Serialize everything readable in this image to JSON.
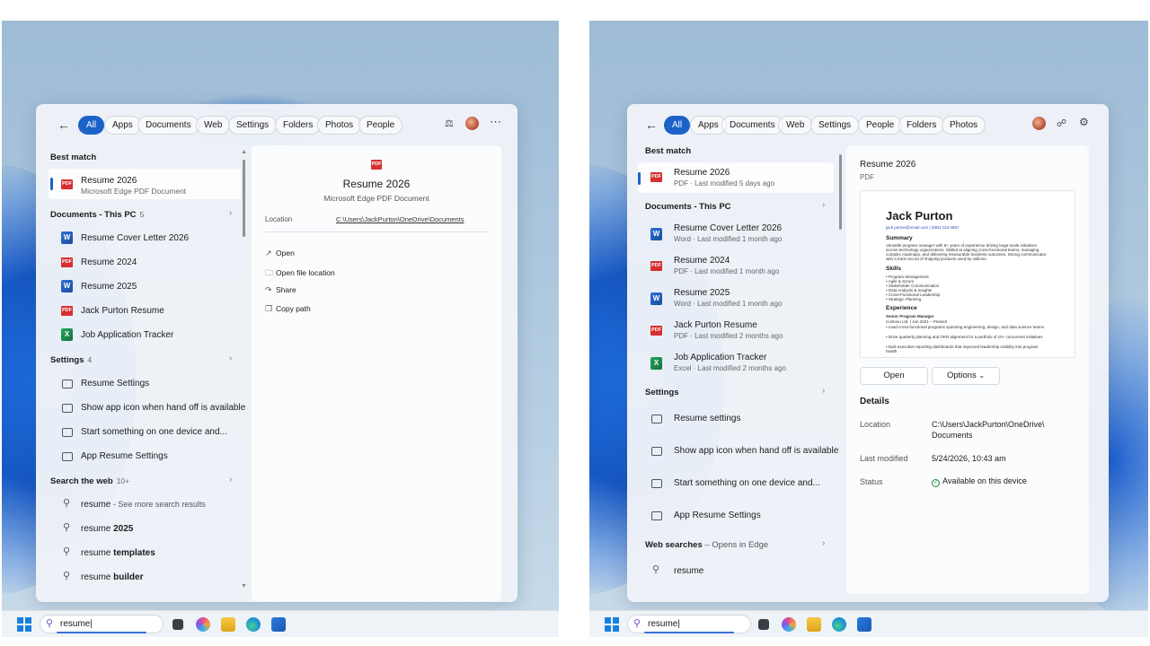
{
  "left": {
    "filters": [
      "All",
      "Apps",
      "Documents",
      "Web",
      "Settings",
      "Folders",
      "Photos",
      "People"
    ],
    "best_match_header": "Best match",
    "best_match": {
      "title": "Resume 2026",
      "subtitle": "Microsoft Edge PDF Document"
    },
    "documents_header": "Documents - This PC",
    "documents_count": "5",
    "documents": [
      {
        "title": "Resume Cover Letter 2026",
        "icon": "word-icon"
      },
      {
        "title": "Resume 2024",
        "icon": "pdf-icon"
      },
      {
        "title": "Resume 2025",
        "icon": "word-icon"
      },
      {
        "title": "Jack Purton Resume",
        "icon": "pdf-icon"
      },
      {
        "title": "Job Application Tracker",
        "icon": "excel-icon"
      }
    ],
    "settings_header": "Settings",
    "settings_count": "4",
    "settings": [
      "Resume Settings",
      "Show app icon when hand off is available",
      "Start something on one device and...",
      "App Resume Settings"
    ],
    "web_header": "Search the web",
    "web_count": "10+",
    "web": [
      {
        "pre": "resume",
        "post": " - See more search results",
        "bold": false
      },
      {
        "pre": "resume ",
        "post": "2025",
        "bold": true
      },
      {
        "pre": "resume ",
        "post": "templates",
        "bold": true
      },
      {
        "pre": "resume ",
        "post": "builder",
        "bold": true
      }
    ],
    "preview": {
      "icon_label": "PDF",
      "title": "Resume 2026",
      "subtitle": "Microsoft Edge PDF Document",
      "location_label": "Location",
      "location_value": "C:\\Users\\JackPurton\\OneDrive\\Documents",
      "actions": [
        "Open",
        "Open file location",
        "Share",
        "Copy path"
      ]
    },
    "search_text": "resume"
  },
  "right": {
    "filters": [
      "All",
      "Apps",
      "Documents",
      "Web",
      "Settings",
      "People",
      "Folders",
      "Photos"
    ],
    "best_match_header": "Best match",
    "best_match": {
      "title": "Resume 2026",
      "subtitle": "PDF · Last modified 5 days ago"
    },
    "documents_header": "Documents - This PC",
    "documents": [
      {
        "title": "Resume Cover Letter 2026",
        "subtitle": "Word · Last modified 1 month ago",
        "icon": "word-icon"
      },
      {
        "title": "Resume 2024",
        "subtitle": "PDF · Last modified 1 month ago",
        "icon": "pdf-icon"
      },
      {
        "title": "Resume 2025",
        "subtitle": "Word · Last modified 1 month ago",
        "icon": "word-icon"
      },
      {
        "title": "Jack Purton Resume",
        "subtitle": "PDF · Last modified 2 months ago",
        "icon": "pdf-icon"
      },
      {
        "title": "Job Application Tracker",
        "subtitle": "Excel · Last modified 2 months ago",
        "icon": "excel-icon"
      }
    ],
    "settings_header": "Settings",
    "settings": [
      "Resume settings",
      "Show app icon when hand off is available",
      "Start something on one device and...",
      "App Resume Settings"
    ],
    "web_header": "Web searches",
    "web_sub": " – Opens in Edge",
    "web": [
      "resume"
    ],
    "preview": {
      "title": "Resume 2026",
      "type": "PDF",
      "doc": {
        "name": "Jack Purton",
        "contact": "jack.purton@email.com | (555) 123-4567",
        "summary_h": "Summary",
        "summary": "Versatile program manager with 8+ years of experience driving large-scale initiatives across technology organizations. Skilled at aligning cross-functional teams, managing complex roadmaps, and delivering measurable business outcomes. Strong communicator with a track record of shipping products used by millions.",
        "skills_h": "Skills",
        "skills": [
          "• Program Management",
          "• Agile & Scrum",
          "• Stakeholder Communication",
          "• Data Analysis & Insights",
          "• Cross-Functional Leadership",
          "• Strategic Planning"
        ],
        "exp_h": "Experience",
        "role": "Senior Program Manager",
        "company": "Contoso Ltd. | Jan 2021 – Present",
        "bullets": [
          "• Lead cross-functional programs spanning engineering, design, and data science teams",
          "• Drive quarterly planning and OKR alignment for a portfolio of 10+ concurrent initiatives",
          "• Built executive reporting dashboards that improved leadership visibility into program health"
        ]
      },
      "open_label": "Open",
      "options_label": "Options",
      "details_header": "Details",
      "location_label": "Location",
      "location_value_1": "C:\\Users\\JackPurton\\OneDrive\\",
      "location_value_2": "Documents",
      "modified_label": "Last modified",
      "modified_value": "5/24/2026, 10:43 am",
      "status_label": "Status",
      "status_value": "Available on this device"
    },
    "search_text": "resume"
  },
  "colors": {
    "accent": "#1d62c8",
    "pdf": "#d62f2f",
    "word": "#2f6fd6",
    "excel": "#27a35a"
  }
}
